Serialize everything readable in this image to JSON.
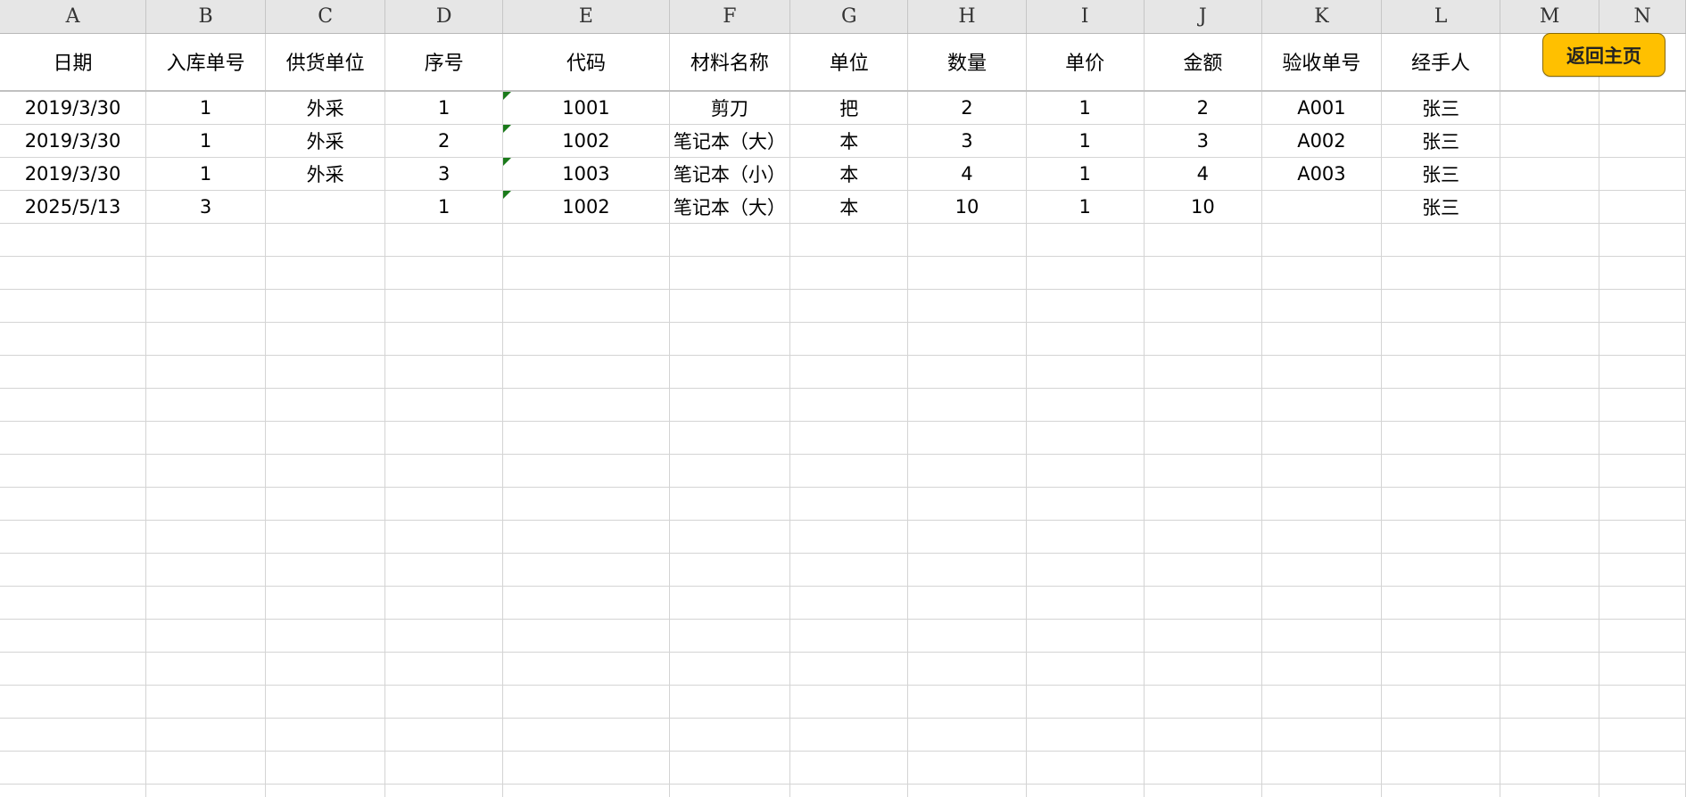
{
  "column_letters": [
    "A",
    "B",
    "C",
    "D",
    "E",
    "F",
    "G",
    "H",
    "I",
    "J",
    "K",
    "L",
    "M",
    "N"
  ],
  "header_labels": [
    "日期",
    "入库单号",
    "供货单位",
    "序号",
    "代码",
    "材料名称",
    "单位",
    "数量",
    "单价",
    "金额",
    "验收单号",
    "经手人"
  ],
  "rows": [
    [
      "2019/3/30",
      "1",
      "外采",
      "1",
      "1001",
      "剪刀",
      "把",
      "2",
      "1",
      "2",
      "A001",
      "张三"
    ],
    [
      "2019/3/30",
      "1",
      "外采",
      "2",
      "1002",
      "笔记本（大）",
      "本",
      "3",
      "1",
      "3",
      "A002",
      "张三"
    ],
    [
      "2019/3/30",
      "1",
      "外采",
      "3",
      "1003",
      "笔记本（小）",
      "本",
      "4",
      "1",
      "4",
      "A003",
      "张三"
    ],
    [
      "2025/5/13",
      "3",
      "",
      "1",
      "1002",
      "笔记本（大）",
      "本",
      "10",
      "1",
      "10",
      "",
      "张三"
    ]
  ],
  "home_button": {
    "label": "返回主页",
    "color": "#ffc000"
  },
  "colors": {
    "header_bg": "#e6e6e6",
    "gridline": "#d4d4d4",
    "text_indicator": "#1a7a1a"
  }
}
